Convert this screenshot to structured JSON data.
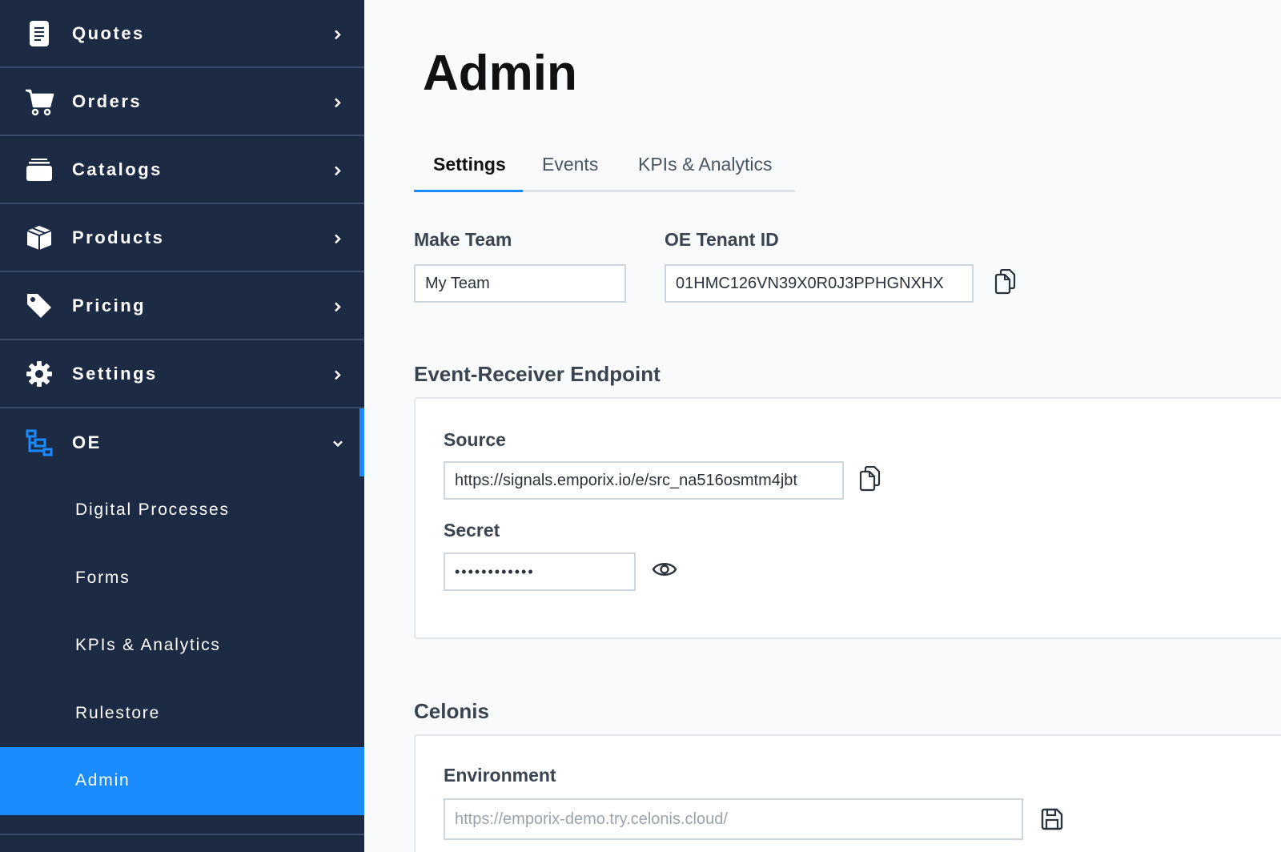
{
  "sidebar": {
    "items": [
      {
        "label": "Quotes",
        "icon": "document-icon"
      },
      {
        "label": "Orders",
        "icon": "cart-icon"
      },
      {
        "label": "Catalogs",
        "icon": "catalog-icon"
      },
      {
        "label": "Products",
        "icon": "box-icon"
      },
      {
        "label": "Pricing",
        "icon": "tag-icon"
      },
      {
        "label": "Settings",
        "icon": "gear-icon"
      },
      {
        "label": "OE",
        "icon": "flow-icon",
        "expanded": true
      }
    ],
    "sub_items": [
      {
        "label": "Digital Processes"
      },
      {
        "label": "Forms"
      },
      {
        "label": "KPIs & Analytics"
      },
      {
        "label": "Rulestore"
      },
      {
        "label": "Admin",
        "active": true
      }
    ]
  },
  "main": {
    "title": "Admin",
    "tabs": [
      {
        "label": "Settings",
        "active": true
      },
      {
        "label": "Events"
      },
      {
        "label": "KPIs & Analytics"
      }
    ],
    "make_team": {
      "label": "Make Team",
      "value": "My Team"
    },
    "tenant": {
      "label": "OE Tenant ID",
      "value": "01HMC126VN39X0R0J3PPHGNXHX"
    },
    "event_receiver": {
      "title": "Event-Receiver Endpoint",
      "source": {
        "label": "Source",
        "value": "https://signals.emporix.io/e/src_na516osmtm4jbt"
      },
      "secret": {
        "label": "Secret",
        "value": "••••••••••••"
      }
    },
    "celonis": {
      "title": "Celonis",
      "environment": {
        "label": "Environment",
        "placeholder": "https://emporix-demo.try.celonis.cloud/"
      }
    }
  },
  "colors": {
    "sidebar_bg": "#1c2a44",
    "accent": "#1a8cff",
    "page_bg": "#f8fafc"
  }
}
